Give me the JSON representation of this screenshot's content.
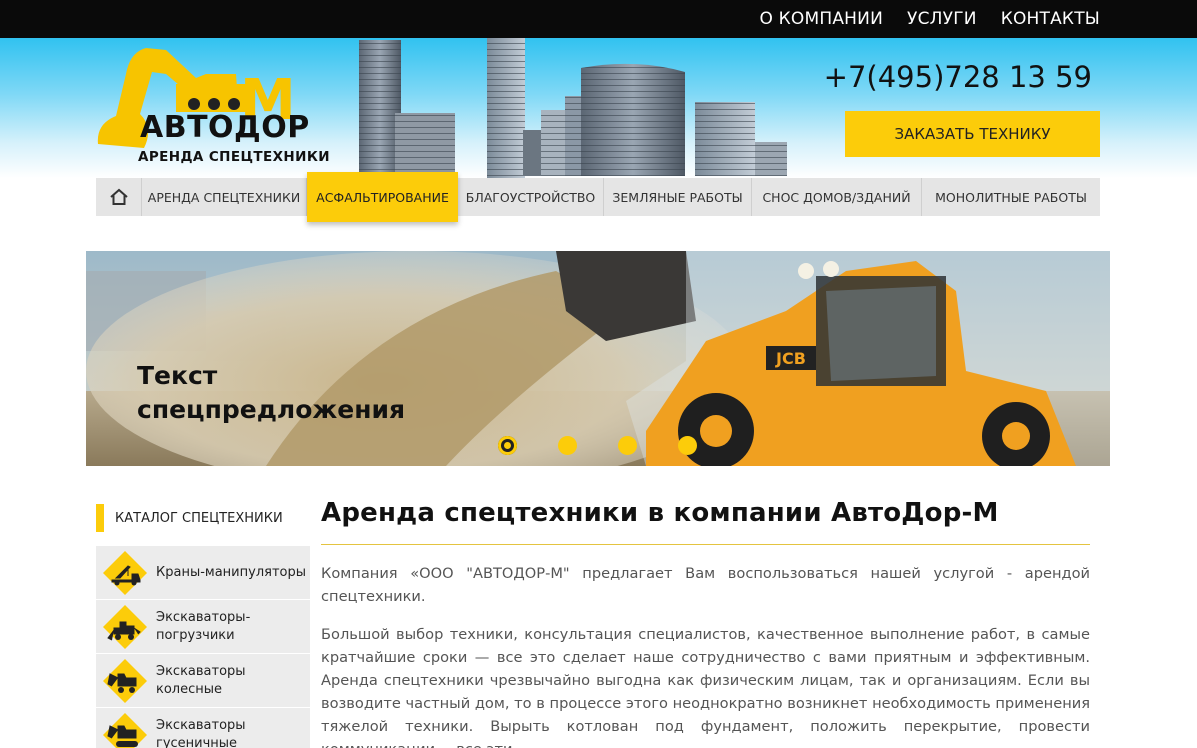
{
  "topnav": {
    "about": "О КОМПАНИИ",
    "services": "УСЛУГИ",
    "contacts": "КОНТАКТЫ"
  },
  "logo": {
    "name": "АВТОДОР",
    "letter": "М",
    "tagline": "АРЕНДА СПЕЦТЕХНИКИ"
  },
  "header": {
    "phone": "+7(495)728 13 59",
    "order_button": "ЗАКАЗАТЬ ТЕХНИКУ"
  },
  "mainnav": {
    "home_icon": "home-icon",
    "items": [
      {
        "label": "АРЕНДА СПЕЦТЕХНИКИ"
      },
      {
        "label": "АСФАЛЬТИРОВАНИЕ",
        "active": true
      },
      {
        "label": "БЛАГОУСТРОЙСТВО"
      },
      {
        "label": "ЗЕМЛЯНЫЕ РАБОТЫ"
      },
      {
        "label": "СНОС ДОМОВ/ЗДАНИЙ"
      },
      {
        "label": "МОНОЛИТНЫЕ РАБОТЫ"
      }
    ]
  },
  "slider": {
    "text_line1": "Текст",
    "text_line2": "спецпредложения",
    "dots_count": 4,
    "active_dot": 1
  },
  "catalog": {
    "title": "КАТАЛОГ СПЕЦТЕХНИКИ",
    "items": [
      {
        "label": "Краны-манипуляторы",
        "icon": "crane-truck-icon"
      },
      {
        "label": "Экскаваторы-погрузчики",
        "icon": "backhoe-loader-icon"
      },
      {
        "label": "Экскаваторы колесные",
        "icon": "wheeled-excavator-icon"
      },
      {
        "label": "Экскаваторы гусеничные",
        "icon": "crawler-excavator-icon"
      }
    ]
  },
  "content": {
    "title": "Аренда спецтехники в компании АвтоДор-М",
    "paragraph1": "Компания «ООО \"АВТОДОР-М\" предлагает Вам воспользоваться нашей услугой - арендой спецтехники.",
    "paragraph2": "Большой выбор техники, консультация специалистов, качественное выполнение работ, в самые кратчайшие сроки — все это сделает наше сотрудничество с вами приятным и эффективным. Аренда спецтехники чрезвычайно выгодна как физическим лицам, так и организациям. Если вы возводите частный дом, то в процессе этого неоднократно возникнет необходимость применения тяжелой техники. Вырыть котлован под фундамент, положить перекрытие, провести коммуникации, – все эти"
  },
  "colors": {
    "accent": "#fccc0a",
    "topbar": "#0a0a0a",
    "nav": "#e5e5e5"
  }
}
